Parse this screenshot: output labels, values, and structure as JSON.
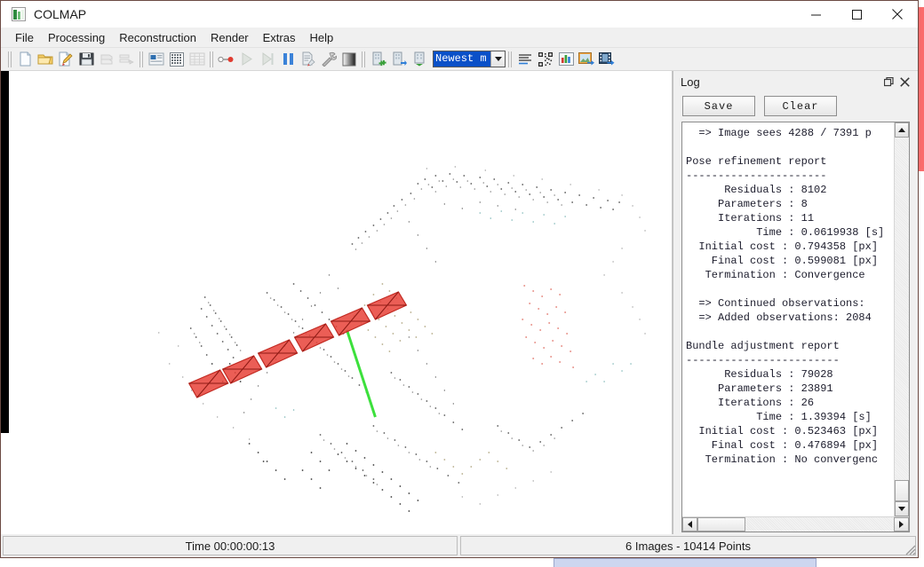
{
  "window": {
    "title": "COLMAP",
    "app_icon": "colmap-logo-icon",
    "minimize_label": "Minimize",
    "maximize_label": "Maximize",
    "close_label": "Close"
  },
  "menubar": {
    "items": [
      {
        "label": "File"
      },
      {
        "label": "Processing"
      },
      {
        "label": "Reconstruction"
      },
      {
        "label": "Render"
      },
      {
        "label": "Extras"
      },
      {
        "label": "Help"
      }
    ]
  },
  "toolbar": {
    "groups": [
      {
        "buttons": [
          {
            "name": "new-project-button",
            "icon": "new-file-icon",
            "label": "New project"
          },
          {
            "name": "open-project-button",
            "icon": "open-folder-icon",
            "label": "Open project"
          },
          {
            "name": "edit-project-button",
            "icon": "edit-page-icon",
            "label": "Edit project"
          },
          {
            "name": "save-project-button",
            "icon": "floppy-save-icon",
            "label": "Save project"
          },
          {
            "name": "import-model-button",
            "icon": "import-stack-icon",
            "label": "Import model",
            "disabled": true
          },
          {
            "name": "export-model-button",
            "icon": "export-stack-icon",
            "label": "Export model",
            "disabled": true
          }
        ]
      },
      {
        "buttons": [
          {
            "name": "feature-extraction-button",
            "icon": "image-pane-icon",
            "label": "Feature extraction"
          },
          {
            "name": "feature-matching-button",
            "icon": "grid-matrix-icon",
            "label": "Feature matching"
          },
          {
            "name": "database-management-button",
            "icon": "table-icon",
            "label": "Database management",
            "disabled": true
          }
        ]
      },
      {
        "buttons": [
          {
            "name": "start-reconstruction-button",
            "icon": "start-node-icon",
            "label": "Start reconstruction"
          },
          {
            "name": "reconstruct-play-button",
            "icon": "play-triangle-icon",
            "label": "Reconstruct",
            "disabled": true
          },
          {
            "name": "reconstruct-step-button",
            "icon": "step-forward-icon",
            "label": "Reconstruct step",
            "disabled": true
          },
          {
            "name": "pause-reconstruction-button",
            "icon": "pause-bars-icon",
            "label": "Pause reconstruction"
          },
          {
            "name": "reconstruction-options-button",
            "icon": "document-edit-icon",
            "label": "Reconstruction options"
          },
          {
            "name": "bundle-adjustment-button",
            "icon": "hammer-icon",
            "label": "Bundle adjustment"
          },
          {
            "name": "dense-reconstruction-button",
            "icon": "gradient-square-icon",
            "label": "Dense reconstruction"
          }
        ]
      },
      {
        "buttons": [
          {
            "name": "add-model-button",
            "icon": "database-add-icon",
            "label": "Add model"
          },
          {
            "name": "next-model-button",
            "icon": "database-next-icon",
            "label": "Next model"
          },
          {
            "name": "merge-models-button",
            "icon": "database-merge-icon",
            "label": "Merge models"
          }
        ]
      }
    ],
    "model_selector": {
      "name": "model-select",
      "value": "Newest m",
      "full_value": "Newest model",
      "selected": true
    },
    "right_group": [
      {
        "name": "show-log-button",
        "icon": "log-lines-icon",
        "label": "Show log"
      },
      {
        "name": "show-match-matrix-button",
        "icon": "match-matrix-icon",
        "label": "Match matrix"
      },
      {
        "name": "show-model-statistics-button",
        "icon": "bar-chart-icon",
        "label": "Model statistics"
      },
      {
        "name": "grab-image-button",
        "icon": "grab-image-icon",
        "label": "Grab image"
      },
      {
        "name": "grab-movie-button",
        "icon": "grab-movie-icon",
        "label": "Grab movie"
      }
    ]
  },
  "log_panel": {
    "title": "Log",
    "float_icon": "undock-icon",
    "close_icon": "close-icon",
    "save_label": "Save",
    "clear_label": "Clear",
    "content": "  => Image sees 4288 / 7391 p\n\nPose refinement report\n----------------------\n      Residuals : 8102\n     Parameters : 8\n     Iterations : 11\n           Time : 0.0619938 [s]\n  Initial cost : 0.794358 [px]\n    Final cost : 0.599081 [px]\n   Termination : Convergence\n\n  => Continued observations:\n  => Added observations: 2084\n\nBundle adjustment report\n------------------------\n      Residuals : 79028\n     Parameters : 23891\n     Iterations : 26\n           Time : 1.39394 [s]\n  Initial cost : 0.523463 [px]\n    Final cost : 0.476894 [px]\n   Termination : No convergenc",
    "reports": {
      "image_sees": {
        "label": "=> Image sees",
        "seen": 4288,
        "total": 7391,
        "unit": "p"
      },
      "pose_refinement": {
        "title": "Pose refinement report",
        "residuals": 8102,
        "parameters": 8,
        "iterations": 11,
        "time": "0.0619938 [s]",
        "initial_cost": "0.794358 [px]",
        "final_cost": "0.599081 [px]",
        "termination": "Convergence"
      },
      "observations": {
        "continued": "=> Continued observations:",
        "added_label": "=> Added observations:",
        "added_value": 2084
      },
      "bundle_adjustment": {
        "title": "Bundle adjustment report",
        "residuals": 79028,
        "parameters": 23891,
        "iterations": 26,
        "time": "1.39394 [s]",
        "initial_cost": "0.523463 [px]",
        "final_cost": "0.476894 [px]",
        "termination": "No convergenc"
      }
    }
  },
  "viewport": {
    "name": "model-viewer",
    "cameras_count": 6,
    "camera_color": "#e8433a",
    "trajectory_color": "#3ce03c",
    "background": "#ffffff"
  },
  "statusbar": {
    "time_label": "Time 00:00:00:13",
    "stats_label": "6 Images - 10414 Points"
  }
}
